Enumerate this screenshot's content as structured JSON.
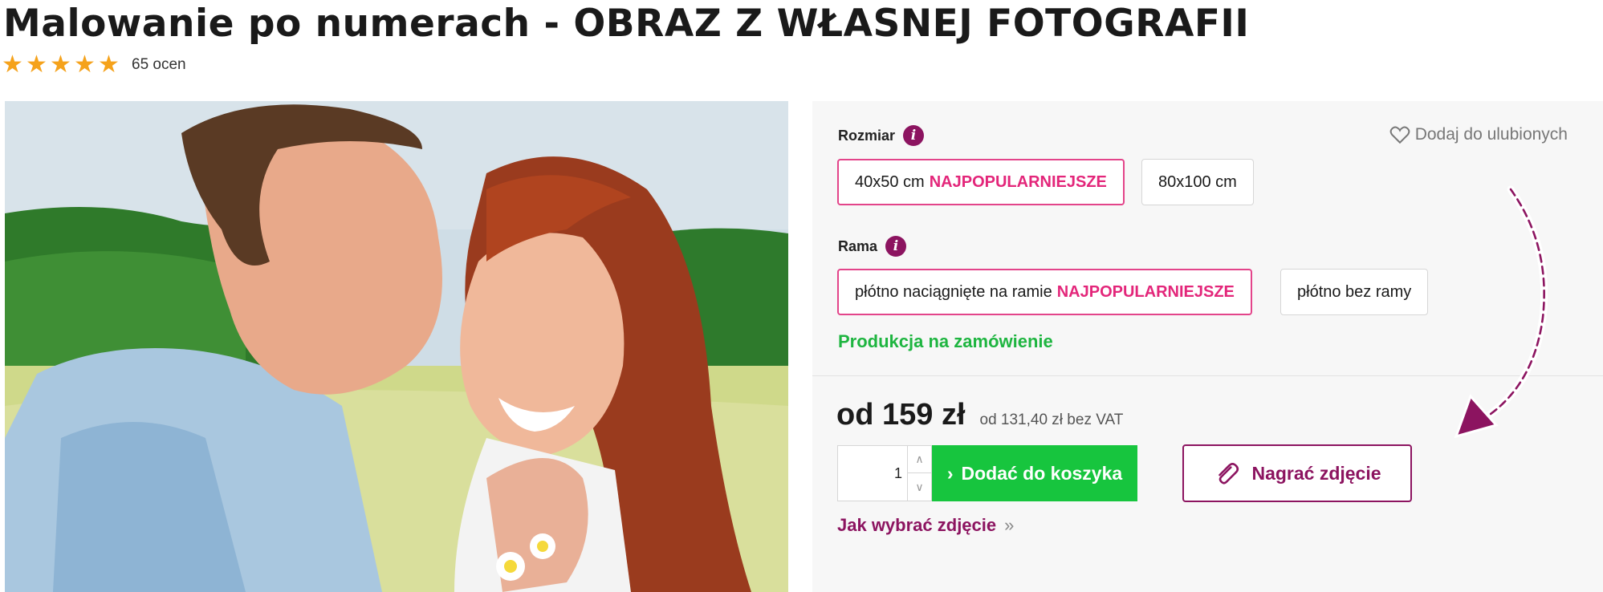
{
  "product": {
    "title": "Malowanie po numerach - OBRAZ Z WŁASNEJ FOTOGRAFII",
    "rating_stars": 5,
    "rating_count": "65 ocen"
  },
  "icons": {
    "star": "★",
    "chevron_right": "›",
    "chevron_up": "∧",
    "chevron_down": "∨",
    "double_chevron": "»",
    "info": "i"
  },
  "options": {
    "size_label": "Rozmiar",
    "sizes": [
      {
        "label": "40x50 cm",
        "badge": "NAJPOPULARNIEJSZE",
        "selected": true
      },
      {
        "label": "80x100 cm",
        "badge": "",
        "selected": false
      }
    ],
    "frame_label": "Rama",
    "frames": [
      {
        "label": "płótno naciągnięte na ramie",
        "badge": "NAJPOPULARNIEJSZE",
        "selected": true
      },
      {
        "label": "płótno bez ramy",
        "badge": "",
        "selected": false
      }
    ]
  },
  "favorite": {
    "label": "Dodaj do ulubionych"
  },
  "availability": "Produkcja na zamówienie",
  "price": {
    "main": "od 159 zł",
    "net": "od 131,40 zł bez VAT"
  },
  "cart": {
    "quantity": "1",
    "add_label": "Dodać do koszyka",
    "upload_label": "Nagrać zdjęcie",
    "how_link": "Jak wybrać zdjęcie"
  },
  "colors": {
    "accent": "#8c1460",
    "badge": "#e3267a",
    "selected_border": "#e3448a",
    "cart_button": "#17c53e",
    "availability": "#1eb540",
    "star": "#f5a21b"
  }
}
